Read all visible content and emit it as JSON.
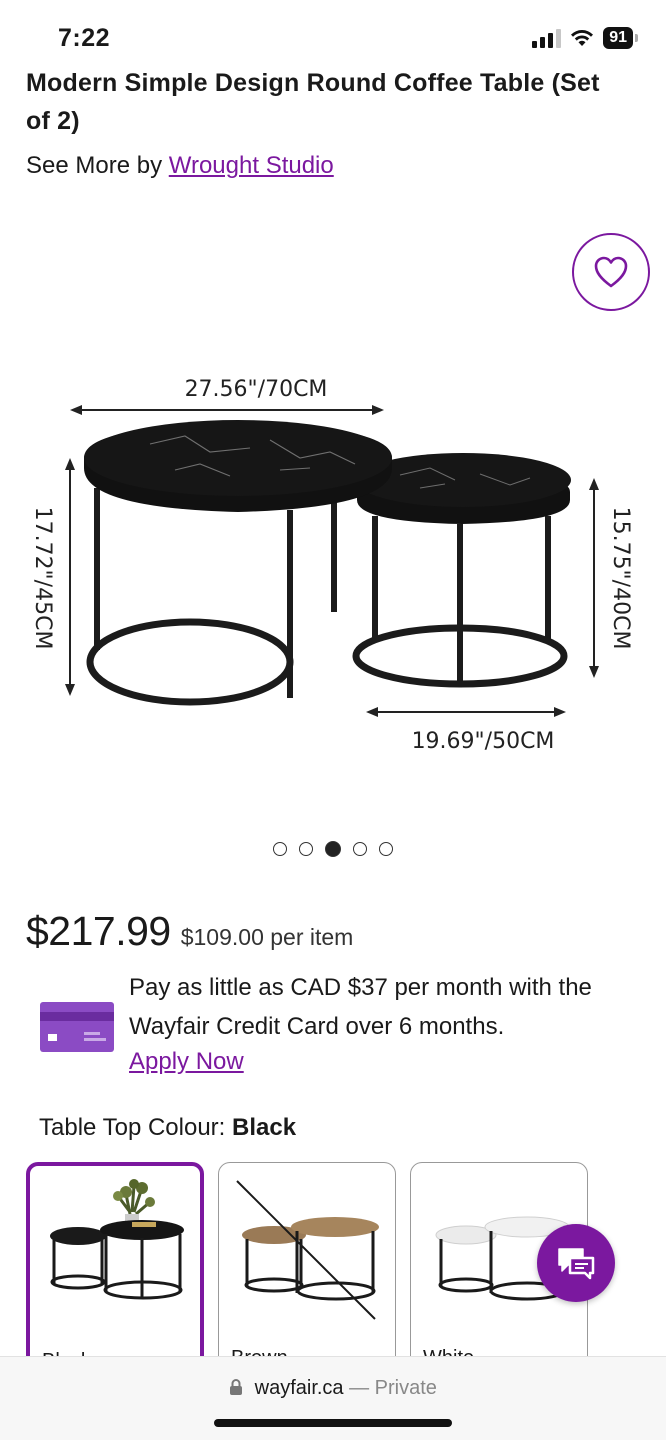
{
  "status_bar": {
    "time": "7:22",
    "battery": "91"
  },
  "product": {
    "title": "Modern Simple Design Round Coffee Table (Set of 2)",
    "see_more_prefix": "See More by",
    "brand": "Wrought Studio"
  },
  "image": {
    "dim_top": "27.56\"/70CM",
    "dim_left": "17.72\"/45CM",
    "dim_right": "15.75\"/40CM",
    "dim_bottom": "19.69\"/50CM",
    "carousel": {
      "total": 5,
      "active_index": 3
    }
  },
  "pricing": {
    "price": "$217.99",
    "per_item": "$109.00 per item"
  },
  "financing": {
    "text": "Pay as little as CAD $37 per month with the Wayfair Credit Card over 6 months.",
    "link": "Apply Now"
  },
  "colour": {
    "label": "Table Top Colour:",
    "selected": "Black",
    "options": [
      {
        "label": "Black",
        "selected": true,
        "available": true
      },
      {
        "label": "Brown",
        "selected": false,
        "available": false
      },
      {
        "label": "White",
        "selected": false,
        "available": true
      }
    ]
  },
  "browser": {
    "domain": "wayfair.ca",
    "mode": "— Private"
  },
  "colors": {
    "accent": "#7b189f",
    "text": "#1a1a1a"
  }
}
